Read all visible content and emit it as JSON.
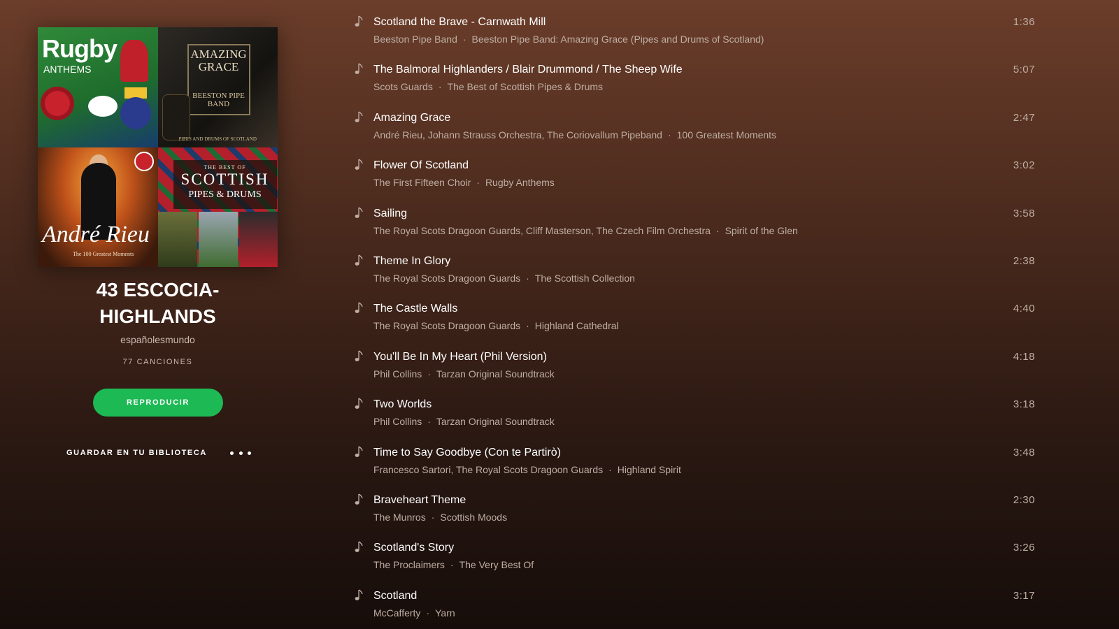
{
  "playlist": {
    "title": "43 ESCOCIA- HIGHLANDS",
    "owner": "españolesmundo",
    "song_count": "77 CANCIONES",
    "play_label": "REPRODUCIR",
    "save_label": "GUARDAR EN TU BIBLIOTECA"
  },
  "cover": {
    "rugby_title": "Rugby",
    "rugby_sub": "ANTHEMS",
    "grace_title": "AMAZING GRACE",
    "grace_band": "BEESTON PIPE BAND",
    "grace_foot": "PIPES AND DRUMS OF SCOTLAND",
    "rieu_name": "André Rieu",
    "rieu_sub": "The 100 Greatest Moments",
    "scot_small": "THE BEST OF",
    "scot_big": "SCOTTISH",
    "scot_sub": "PIPES & DRUMS"
  },
  "colors": {
    "accent": "#1db954",
    "muted_text": "#bfaea4"
  },
  "icons": {
    "track": "music-note-icon",
    "more": "ellipsis-icon"
  },
  "tracks": [
    {
      "title": "Scotland the Brave - Carnwath Mill",
      "artist": "Beeston Pipe Band",
      "album": "Beeston Pipe Band: Amazing Grace (Pipes and Drums of Scotland)",
      "duration": "1:36"
    },
    {
      "title": "The Balmoral Highlanders / Blair Drummond / The Sheep Wife",
      "artist": "Scots Guards",
      "album": "The Best of Scottish Pipes & Drums",
      "duration": "5:07"
    },
    {
      "title": "Amazing Grace",
      "artist": "André Rieu, Johann Strauss Orchestra, The Coriovallum Pipeband",
      "album": "100 Greatest Moments",
      "duration": "2:47"
    },
    {
      "title": "Flower Of Scotland",
      "artist": "The First Fifteen Choir",
      "album": "Rugby Anthems",
      "duration": "3:02"
    },
    {
      "title": "Sailing",
      "artist": "The Royal Scots Dragoon Guards, Cliff Masterson, The Czech Film Orchestra",
      "album": "Spirit of the Glen",
      "duration": "3:58"
    },
    {
      "title": "Theme In Glory",
      "artist": "The Royal Scots Dragoon Guards",
      "album": "The Scottish Collection",
      "duration": "2:38"
    },
    {
      "title": "The Castle Walls",
      "artist": "The Royal Scots Dragoon Guards",
      "album": "Highland Cathedral",
      "duration": "4:40"
    },
    {
      "title": "You'll Be In My Heart (Phil Version)",
      "artist": "Phil Collins",
      "album": "Tarzan Original Soundtrack",
      "duration": "4:18"
    },
    {
      "title": "Two Worlds",
      "artist": "Phil Collins",
      "album": "Tarzan Original Soundtrack",
      "duration": "3:18"
    },
    {
      "title": "Time to Say Goodbye (Con te Partirò)",
      "artist": "Francesco Sartori, The Royal Scots Dragoon Guards",
      "album": "Highland Spirit",
      "duration": "3:48"
    },
    {
      "title": "Braveheart Theme",
      "artist": "The Munros",
      "album": "Scottish Moods",
      "duration": "2:30"
    },
    {
      "title": "Scotland's Story",
      "artist": "The Proclaimers",
      "album": "The Very Best Of",
      "duration": "3:26"
    },
    {
      "title": "Scotland",
      "artist": "McCafferty",
      "album": "Yarn",
      "duration": "3:17"
    }
  ]
}
